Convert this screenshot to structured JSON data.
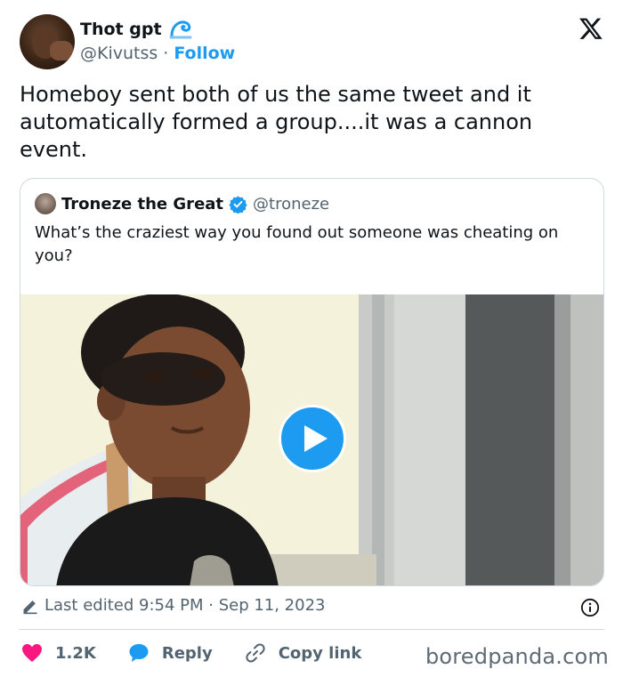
{
  "author": {
    "display_name": "Thot gpt",
    "handle": "@Kivutss",
    "separator": "·",
    "follow_label": "Follow"
  },
  "tweet": {
    "text": "Homeboy sent both of us the same tweet and it automatically formed a group....it was a cannon event."
  },
  "quoted_tweet": {
    "display_name": "Troneze the Great",
    "handle": "@troneze",
    "text": "What’s the craziest way you found out someone was cheating on you?"
  },
  "meta": {
    "edited_text": "Last edited 9:54 PM · Sep 11, 2023"
  },
  "actions": {
    "like_count": "1.2K",
    "reply_label": "Reply",
    "copy_link_label": "Copy link"
  },
  "watermark": "boredpanda.com",
  "icons": {
    "brand": "x-logo-icon",
    "emoji": "wave-icon",
    "verified": "verified-badge-icon",
    "play": "play-icon",
    "edit": "pencil-icon",
    "info": "info-icon",
    "like": "heart-icon",
    "reply": "speech-bubble-icon",
    "copy": "link-icon"
  },
  "colors": {
    "accent": "#1d9bf0",
    "like": "#f91880",
    "text_primary": "#0f1419",
    "text_secondary": "#536471",
    "border": "#cfd9de"
  }
}
